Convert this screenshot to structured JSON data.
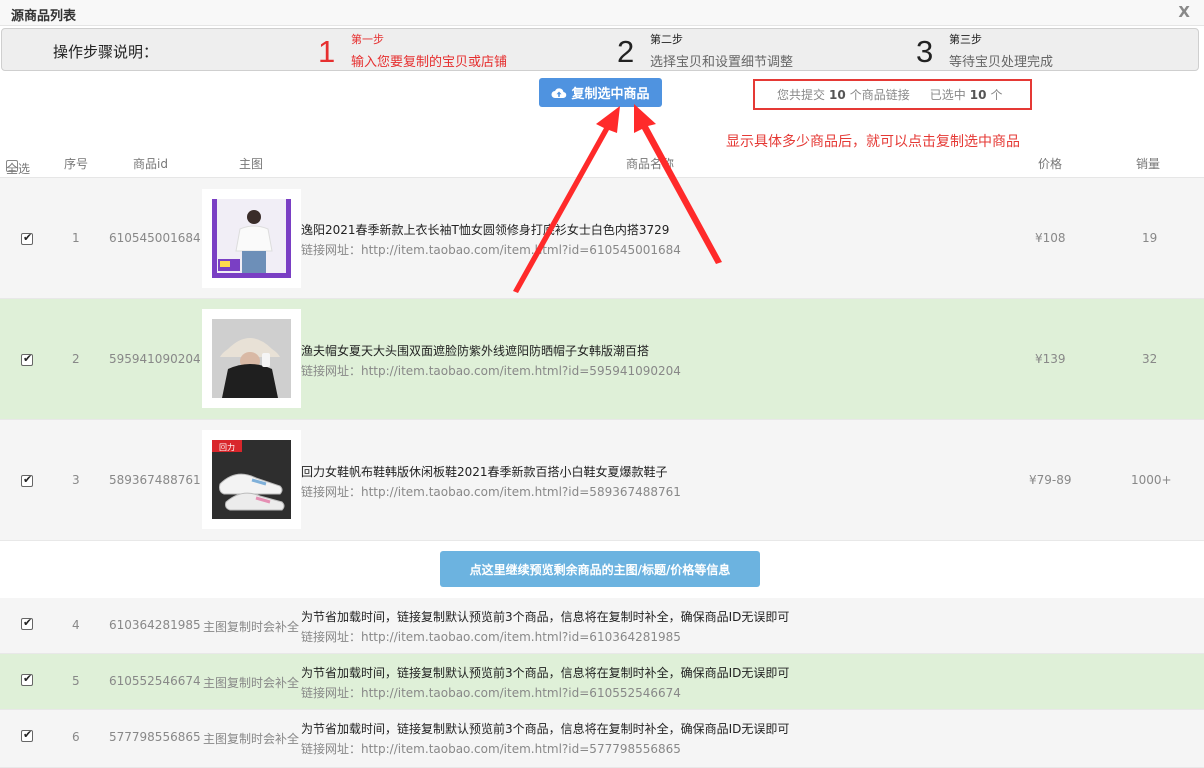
{
  "window": {
    "title": "源商品列表",
    "close_label": "X"
  },
  "steps": {
    "label": "操作步骤说明：",
    "items": [
      {
        "num": "1",
        "title": "第一步",
        "desc": "输入您要复制的宝贝或店铺"
      },
      {
        "num": "2",
        "title": "第二步",
        "desc": "选择宝贝和设置细节调整"
      },
      {
        "num": "3",
        "title": "第三步",
        "desc": "等待宝贝处理完成"
      }
    ]
  },
  "toolbar": {
    "copy_label": "复制选中商品"
  },
  "summary": {
    "prefix": "您共提交",
    "count": "10",
    "suffix": "个商品链接",
    "selected_prefix": "已选中",
    "selected_count": "10",
    "selected_suffix": "个"
  },
  "annotation": "显示具体多少商品后，就可以点击复制选中商品",
  "table": {
    "headers": {
      "select_all": "全选",
      "index": "序号",
      "id": "商品id",
      "image": "主图",
      "name": "商品名称",
      "price": "价格",
      "sales": "销量"
    },
    "rows": [
      {
        "index": "1",
        "id": "610545001684",
        "name": "逸阳2021春季新款上衣长袖T恤女圆领修身打底衫女士白色内搭3729",
        "link": "链接网址：http://item.taobao.com/item.html?id=610545001684",
        "price": "¥108",
        "sales": "19"
      },
      {
        "index": "2",
        "id": "595941090204",
        "name": "渔夫帽女夏天大头围双面遮脸防紫外线遮阳防晒帽子女韩版潮百搭",
        "link": "链接网址：http://item.taobao.com/item.html?id=595941090204",
        "price": "¥139",
        "sales": "32"
      },
      {
        "index": "3",
        "id": "589367488761",
        "name": "回力女鞋帆布鞋韩版休闲板鞋2021春季新款百搭小白鞋女夏爆款鞋子",
        "link": "链接网址：http://item.taobao.com/item.html?id=589367488761",
        "price": "¥79-89",
        "sales": "1000+"
      }
    ],
    "more_button": "点这里继续预览剩余商品的主图/标题/价格等信息",
    "pending_rows": [
      {
        "index": "4",
        "id": "610364281985",
        "image_note": "主图复制时会补全",
        "name": "为节省加载时间，链接复制默认预览前3个商品，信息将在复制时补全，确保商品ID无误即可",
        "link": "链接网址：http://item.taobao.com/item.html?id=610364281985"
      },
      {
        "index": "5",
        "id": "610552546674",
        "image_note": "主图复制时会补全",
        "name": "为节省加载时间，链接复制默认预览前3个商品，信息将在复制时补全，确保商品ID无误即可",
        "link": "链接网址：http://item.taobao.com/item.html?id=610552546674"
      },
      {
        "index": "6",
        "id": "577798556865",
        "image_note": "主图复制时会补全",
        "name": "为节省加载时间，链接复制默认预览前3个商品，信息将在复制时补全，确保商品ID无误即可",
        "link": "链接网址：http://item.taobao.com/item.html?id=577798556865"
      }
    ]
  },
  "thumb_badges": {
    "row3_logo": "回力"
  },
  "colors": {
    "accent": "#4f93e0",
    "alert": "#e53935",
    "row_green": "#dff0d8",
    "row_gray": "#f5f5f5"
  }
}
